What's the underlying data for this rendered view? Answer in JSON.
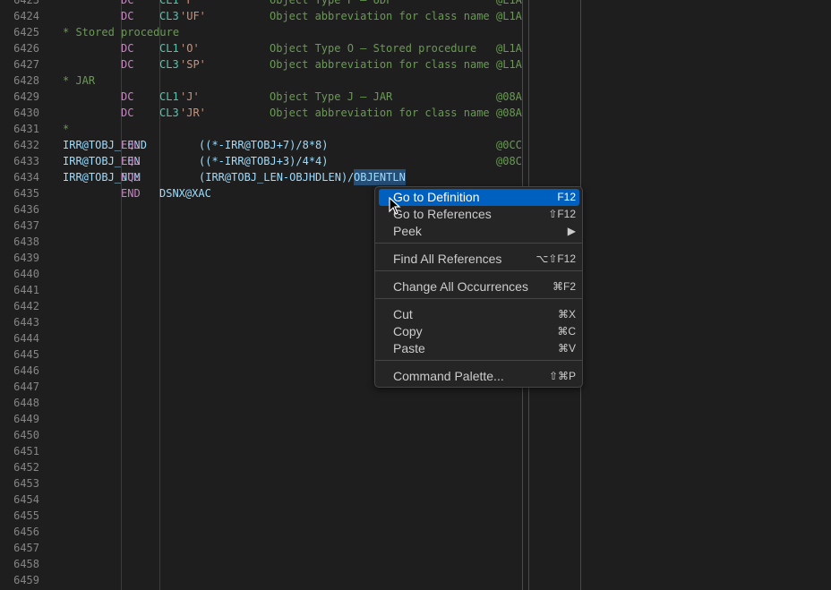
{
  "lines": [
    {
      "n": "6423",
      "label": "",
      "op": "DC",
      "type": "CL1",
      "lit": "'F'",
      "comment": "Object Type F – UDF",
      "tag": "@L1A"
    },
    {
      "n": "6424",
      "label": "",
      "op": "DC",
      "type": "CL3",
      "lit": "'UF'",
      "comment": "Object abbreviation for class name",
      "tag": "@L1A"
    },
    {
      "n": "6425",
      "full": "* Stored procedure"
    },
    {
      "n": "6426",
      "label": "",
      "op": "DC",
      "type": "CL1",
      "lit": "'O'",
      "comment": "Object Type O – Stored procedure",
      "tag": "@L1A"
    },
    {
      "n": "6427",
      "label": "",
      "op": "DC",
      "type": "CL3",
      "lit": "'SP'",
      "comment": "Object abbreviation for class name",
      "tag": "@L1A"
    },
    {
      "n": "6428",
      "full": "* JAR"
    },
    {
      "n": "6429",
      "label": "",
      "op": "DC",
      "type": "CL1",
      "lit": "'J'",
      "comment": "Object Type J – JAR",
      "tag": "@08A"
    },
    {
      "n": "6430",
      "label": "",
      "op": "DC",
      "type": "CL3",
      "lit": "'JR'",
      "comment": "Object abbreviation for class name",
      "tag": "@08A"
    },
    {
      "n": "6431",
      "full": "*"
    },
    {
      "n": "6432",
      "label": "IRR@TOBJ_LEND",
      "op": "EQU",
      "expr": "((*-IRR@TOBJ+7)/8*8)",
      "tag": "@0CC"
    },
    {
      "n": "6433",
      "label": "IRR@TOBJ_LEN",
      "op": "EQU",
      "expr": "((*-IRR@TOBJ+3)/4*4)",
      "tag": "@08C"
    },
    {
      "n": "6434",
      "label": "IRR@TOBJ_NUM",
      "op": "EQU",
      "expr": "(IRR@TOBJ_LEN-OBJHDLEN)/",
      "sel": "OBJENTLN"
    },
    {
      "n": "6435",
      "label": "",
      "op": "END",
      "operand": "DSNX@XAC"
    },
    {
      "n": "6436"
    },
    {
      "n": "6437"
    },
    {
      "n": "6438"
    },
    {
      "n": "6439"
    },
    {
      "n": "6440"
    },
    {
      "n": "6441"
    },
    {
      "n": "6442"
    },
    {
      "n": "6443"
    },
    {
      "n": "6444"
    },
    {
      "n": "6445"
    },
    {
      "n": "6446"
    },
    {
      "n": "6447"
    },
    {
      "n": "6448"
    },
    {
      "n": "6449"
    },
    {
      "n": "6450"
    },
    {
      "n": "6451"
    },
    {
      "n": "6452"
    },
    {
      "n": "6453"
    },
    {
      "n": "6454"
    },
    {
      "n": "6455"
    },
    {
      "n": "6456"
    },
    {
      "n": "6457"
    },
    {
      "n": "6458"
    },
    {
      "n": "6459"
    }
  ],
  "context_menu": {
    "items": [
      {
        "label": "Go to Definition",
        "key": "F12",
        "active": true
      },
      {
        "label": "Go to References",
        "key": "⇧F12"
      },
      {
        "label": "Peek",
        "key": "▶"
      },
      {
        "sep": true
      },
      {
        "label": "Find All References",
        "key": "⌥⇧F12"
      },
      {
        "sep": true
      },
      {
        "label": "Change All Occurrences",
        "key": "⌘F2"
      },
      {
        "sep": true
      },
      {
        "label": "Cut",
        "key": "⌘X"
      },
      {
        "label": "Copy",
        "key": "⌘C"
      },
      {
        "label": "Paste",
        "key": "⌘V"
      },
      {
        "sep": true
      },
      {
        "label": "Command Palette...",
        "key": "⇧⌘P"
      }
    ]
  },
  "colors": {
    "background": "#1e1e1e",
    "menu_active": "#0060c0"
  }
}
